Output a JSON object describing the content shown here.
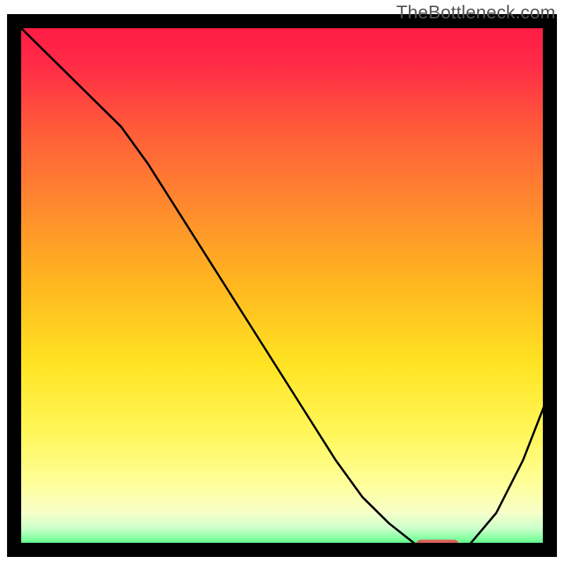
{
  "watermark": "TheBottleneck.com",
  "chart_data": {
    "type": "line",
    "title": "",
    "xlabel": "",
    "ylabel": "",
    "xlim": [
      0,
      100
    ],
    "ylim": [
      0,
      100
    ],
    "x": [
      0,
      5,
      10,
      15,
      20,
      25,
      30,
      35,
      40,
      45,
      50,
      55,
      60,
      65,
      70,
      75,
      80,
      85,
      90,
      95,
      100
    ],
    "values": [
      100,
      95,
      90,
      85,
      80,
      73,
      65,
      57,
      49,
      41,
      33,
      25,
      17,
      10,
      5,
      1,
      0,
      1,
      7,
      17,
      30
    ],
    "marker_segment": {
      "x_start": 75,
      "x_end": 83,
      "y": 1
    },
    "colors": {
      "line": "#000000",
      "marker": "#d9605a",
      "frame": "#000000",
      "gradient_stops": [
        {
          "offset": 0.0,
          "color": "#ff1a44"
        },
        {
          "offset": 0.08,
          "color": "#ff2a46"
        },
        {
          "offset": 0.2,
          "color": "#ff5a3a"
        },
        {
          "offset": 0.35,
          "color": "#ff8a2e"
        },
        {
          "offset": 0.5,
          "color": "#ffb81f"
        },
        {
          "offset": 0.65,
          "color": "#ffe423"
        },
        {
          "offset": 0.78,
          "color": "#fff75a"
        },
        {
          "offset": 0.88,
          "color": "#ffff9e"
        },
        {
          "offset": 0.93,
          "color": "#f6ffc9"
        },
        {
          "offset": 0.96,
          "color": "#caffca"
        },
        {
          "offset": 0.98,
          "color": "#7eff9c"
        },
        {
          "offset": 1.0,
          "color": "#1fd96a"
        }
      ]
    }
  }
}
